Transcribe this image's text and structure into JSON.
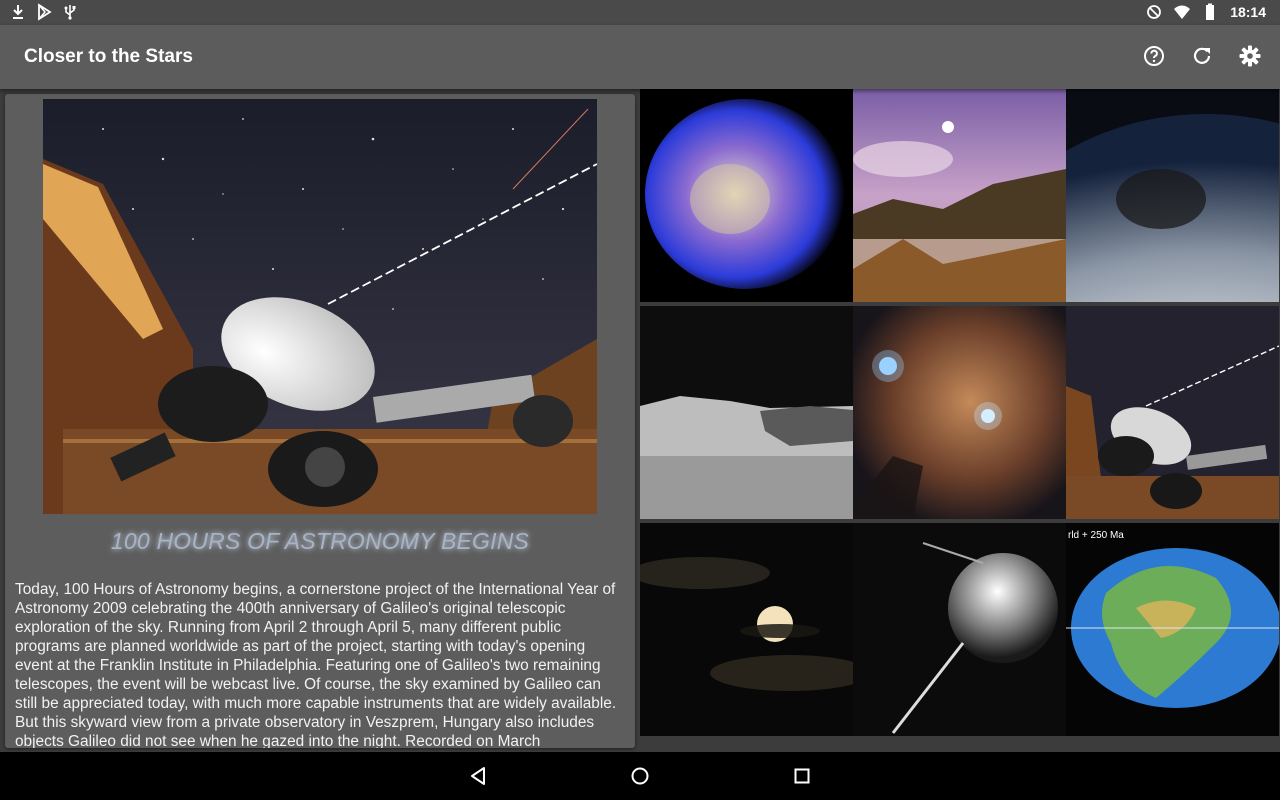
{
  "status_bar": {
    "time": "18:14",
    "left_icons": [
      "download-icon",
      "play-store-icon",
      "usb-icon"
    ],
    "right_icons": [
      "do-not-disturb-icon",
      "wifi-icon",
      "battery-icon"
    ]
  },
  "app_bar": {
    "title": "Closer to the Stars",
    "actions": [
      "help-icon",
      "refresh-icon",
      "settings-icon"
    ]
  },
  "detail": {
    "headline": "100 HOURS OF ASTRONOMY BEGINS",
    "body": "Today, 100 Hours of Astronomy begins, a cornerstone project of the International Year of Astronomy 2009 celebrating the 400th anniversary of Galileo's original telescopic exploration of the sky. Running from April 2 through April 5, many different public programs are planned worldwide as part of the project, starting with today's opening event at the Franklin Institute in Philadelphia. Featuring one of Galileo's two remaining telescopes, the event will be webcast live. Of course, the sky examined by Galileo can still be appreciated today, with much more capable instruments that are widely available. But this skyward view from a private observatory in Veszprem, Hungary also includes objects Galileo did not see when he gazed into the night. Recorded on March"
  },
  "grid": {
    "tiles": [
      {
        "subject": "supernova-remnant"
      },
      {
        "subject": "alien-shore-landscape"
      },
      {
        "subject": "eclipse-shadow-on-earth"
      },
      {
        "subject": "lunar-surface"
      },
      {
        "subject": "pelican-nebula"
      },
      {
        "subject": "telescope-observatory"
      },
      {
        "subject": "moon-behind-clouds"
      },
      {
        "subject": "sputnik-satellite"
      },
      {
        "subject": "pangea-map",
        "label": "rld   + 250 Ma"
      }
    ]
  },
  "nav_bar": [
    "back-icon",
    "home-icon",
    "recents-icon"
  ]
}
